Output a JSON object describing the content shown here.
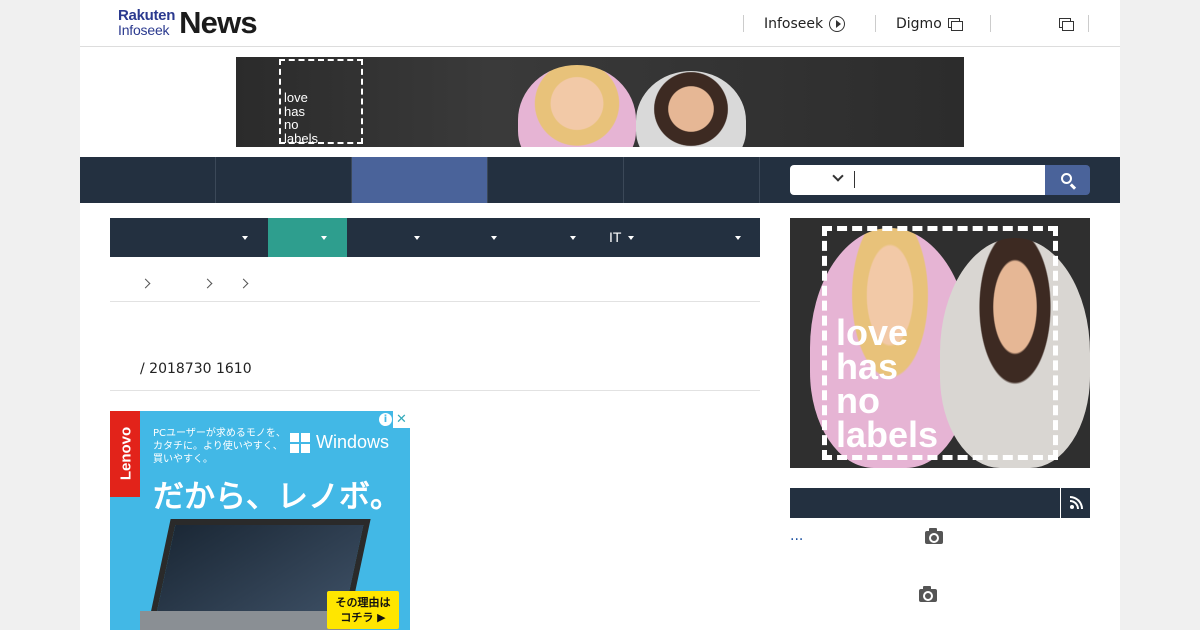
{
  "header": {
    "logo": {
      "line1": "Rakuten",
      "line2": "Infoseek",
      "line3": "News"
    },
    "links": [
      {
        "label": "Infoseek",
        "icon": "circle-arrow-icon"
      },
      {
        "label": "Digmo",
        "icon": "new-window-icon"
      },
      {
        "label": "",
        "icon": "new-window-icon"
      }
    ]
  },
  "banner_ad": {
    "text_lines": [
      "love",
      "has",
      "no",
      "labels"
    ]
  },
  "main_nav": {
    "items": [
      "",
      "",
      "",
      "",
      ""
    ],
    "active_index": 2
  },
  "search": {
    "category": "",
    "placeholder": "",
    "icon": "search-icon"
  },
  "category_bar": {
    "items": [
      "",
      "",
      "",
      "",
      "",
      "IT",
      ""
    ],
    "active_index": 1
  },
  "breadcrumb": {
    "items": [
      "",
      "",
      "",
      ""
    ]
  },
  "article": {
    "byline": "/ 2018730 1610"
  },
  "article_ad": {
    "brand": "Lenovo",
    "small_text": "PCユーザーが求めるモノを、カタチに。より使いやすく、買いやすく。",
    "small_lines": [
      "PCユーザーが求めるモノを、",
      "カタチに。より使いやすく、",
      "買いやすく。"
    ],
    "windows_label": "Windows",
    "headline": "だから、レノボ。",
    "cta_lines": [
      "その理由は",
      "コチラ ▶"
    ],
    "choice_icon": "adchoices-icon",
    "close_label": "✕"
  },
  "sidebar": {
    "ad_text_lines": [
      "love",
      "has",
      "no",
      "labels"
    ],
    "section_title": "",
    "rss_icon": "rss-icon",
    "items": [
      {
        "text": "...",
        "icon": "camera-icon"
      },
      {
        "text": "",
        "icon": "camera-icon"
      }
    ]
  },
  "colors": {
    "nav_bg": "#233040",
    "nav_active": "#4a639a",
    "category_active": "#2e9e8e",
    "ad_blue": "#42b8e6",
    "lenovo_red": "#e2231a",
    "cta_yellow": "#ffe600"
  }
}
